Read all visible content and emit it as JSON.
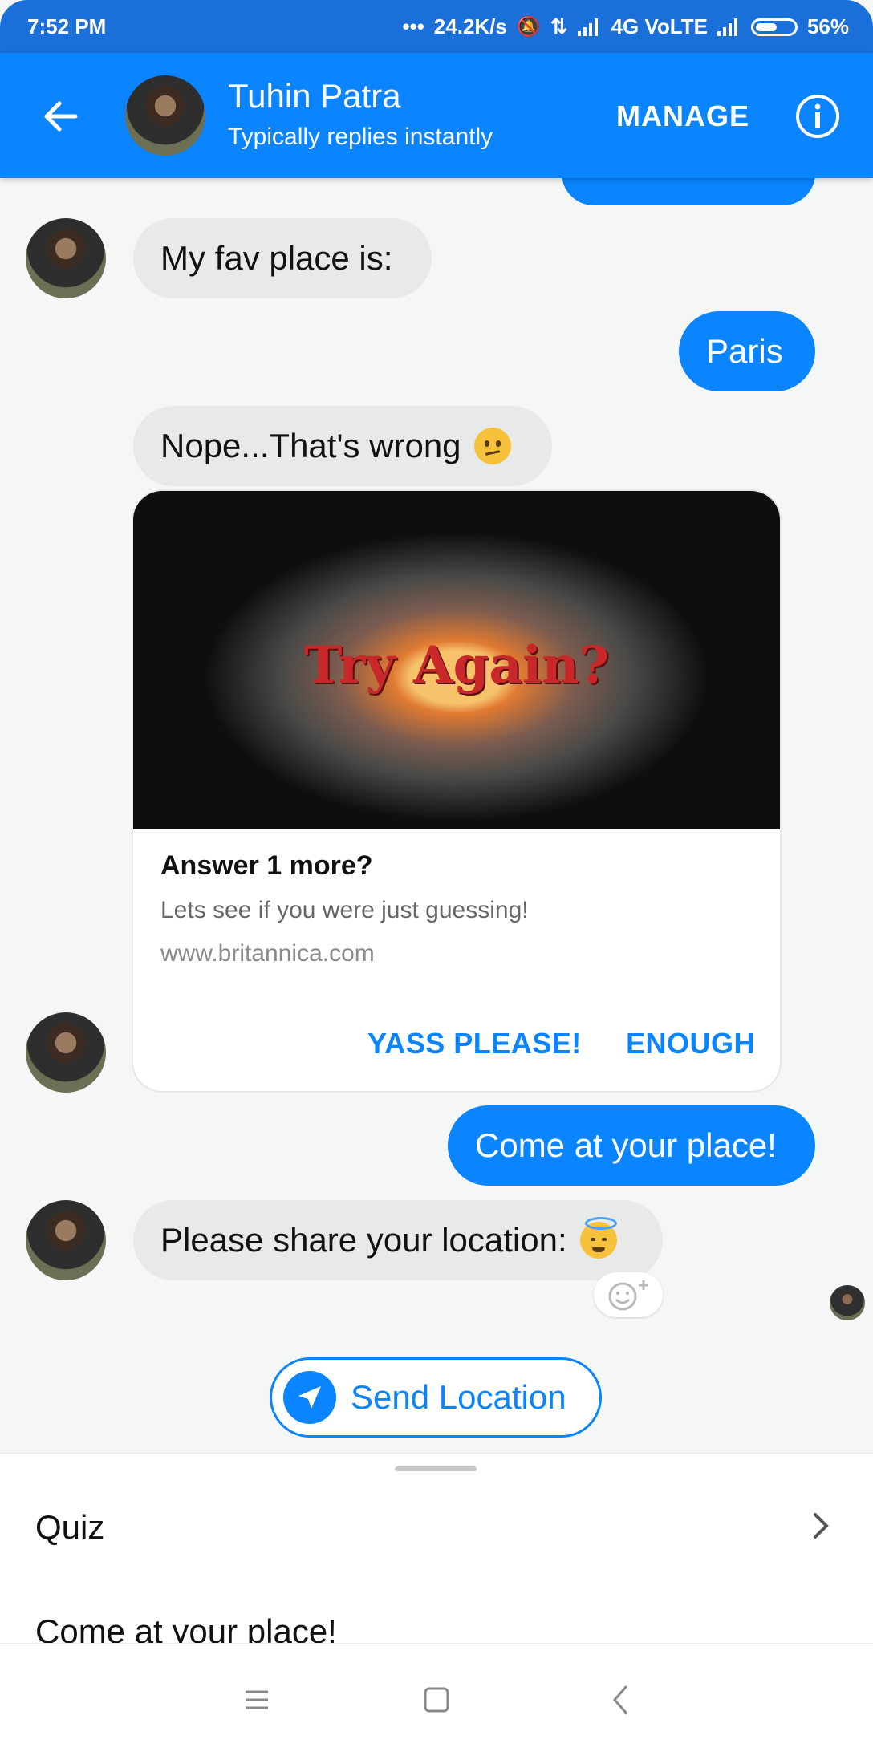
{
  "status_bar": {
    "time": "7:52 PM",
    "speed": "24.2K/s",
    "network": "4G VoLTE",
    "battery": "56%"
  },
  "header": {
    "name": "Tuhin Patra",
    "status": "Typically replies instantly",
    "manage_label": "MANAGE"
  },
  "messages": {
    "fav_place": "My fav place is:",
    "paris": "Paris",
    "nope": "Nope...That's wrong",
    "come": "Come at your place!",
    "share": "Please share your location:"
  },
  "card": {
    "image_text": "Try Again?",
    "title": "Answer 1 more?",
    "subtitle": "Lets see if you were just guessing!",
    "url": "www.britannica.com",
    "btn_yes": "YASS PLEASE!",
    "btn_enough": "ENOUGH"
  },
  "send_location": "Send Location",
  "quick_replies": {
    "quiz": "Quiz",
    "come": "Come at your place!"
  },
  "colors": {
    "accent": "#0a84ff",
    "status_bar": "#1a6fd8"
  },
  "icons": [
    "back-arrow-icon",
    "info-icon",
    "emoji-add-icon",
    "location-arrow-icon",
    "chevron-right-icon",
    "menu-icon",
    "home-square-icon",
    "back-chevron-icon"
  ]
}
